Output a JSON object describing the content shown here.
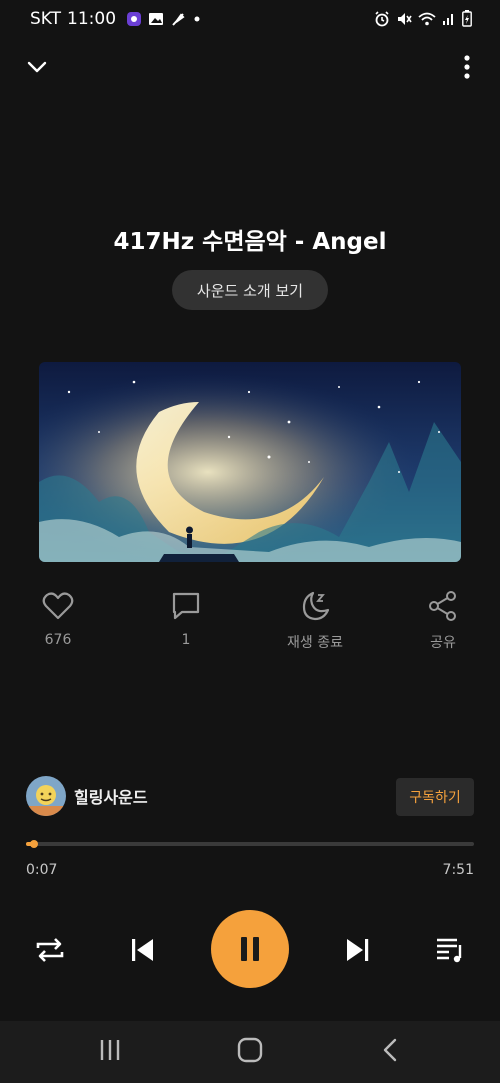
{
  "status_bar": {
    "carrier": "SKT",
    "time": "11:00"
  },
  "player": {
    "title": "417Hz 수면음악 - Angel",
    "intro_button_label": "사운드 소개 보기"
  },
  "actions": [
    {
      "icon": "heart-icon",
      "label": "676"
    },
    {
      "icon": "comment-icon",
      "label": "1"
    },
    {
      "icon": "sleep-timer-icon",
      "label": "재생 종료"
    },
    {
      "icon": "share-icon",
      "label": "공유"
    }
  ],
  "channel": {
    "name": "힐링사운드",
    "subscribe_label": "구독하기"
  },
  "progress": {
    "current": "0:07",
    "total": "7:51",
    "fraction": 0.015
  },
  "colors": {
    "accent": "#f5a13c",
    "background": "#131313",
    "muted": "#9a9a9a"
  }
}
